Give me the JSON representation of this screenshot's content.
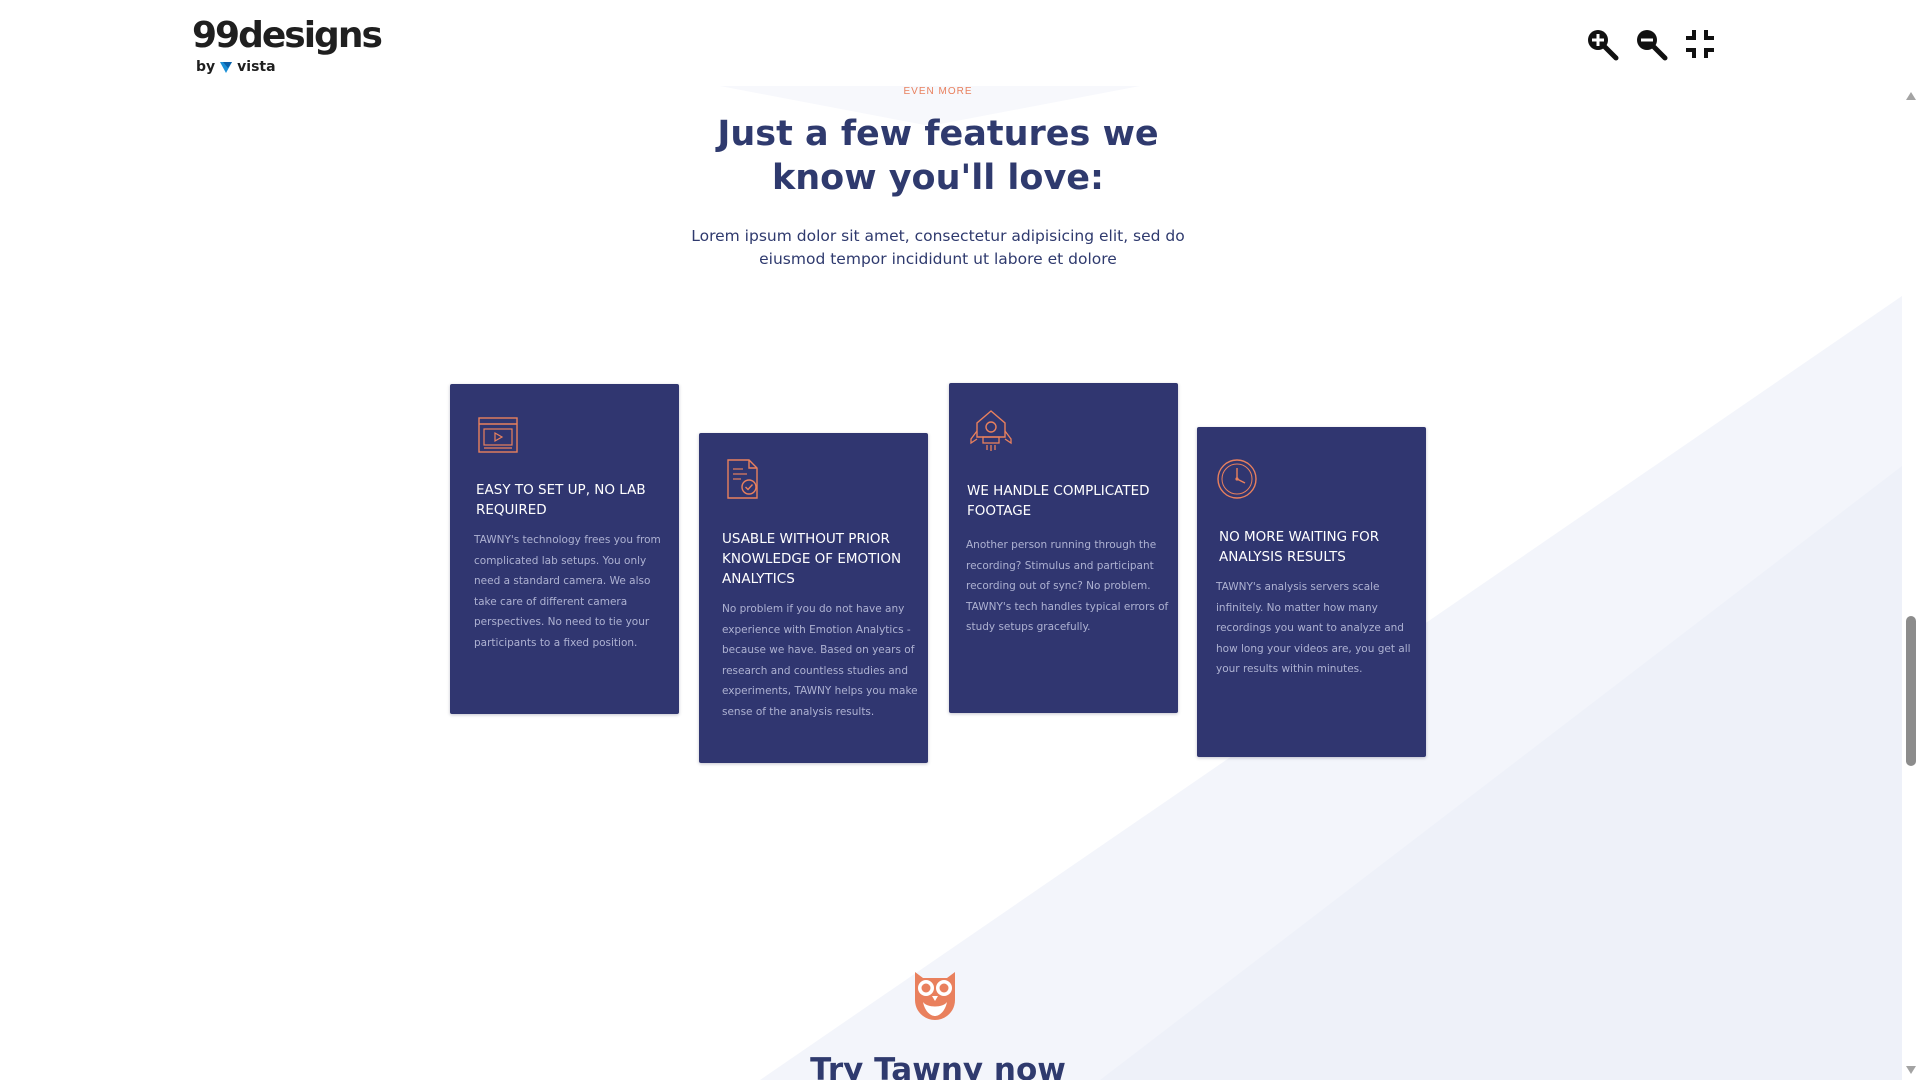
{
  "viewer": {
    "brand": {
      "name": "99designs",
      "by_text": "by",
      "partner": "vista"
    },
    "controls": [
      {
        "name": "zoom-in",
        "icon": "zoom-in-icon"
      },
      {
        "name": "zoom-out",
        "icon": "zoom-out-icon"
      },
      {
        "name": "exit-fullscreen",
        "icon": "collapse-icon"
      }
    ]
  },
  "section": {
    "eyebrow": "EVEN MORE",
    "headline": "Just a few features we know you'll love:",
    "subtext": "Lorem ipsum dolor sit amet, consectetur adipisicing elit, sed do eiusmod tempor incididunt ut labore et dolore"
  },
  "features": [
    {
      "icon": "video-player-icon",
      "title": "EASY TO SET UP, NO LAB REQUIRED",
      "body": "TAWNY's technology frees you from complicated lab setups. You only need a standard camera. We also take care of different camera perspectives. No need to tie your participants to a fixed position."
    },
    {
      "icon": "document-check-icon",
      "title": "USABLE WITHOUT PRIOR KNOWLEDGE OF EMOTION ANALYTICS",
      "body": "No problem if you do not have any experience with Emotion Analytics - because we have. Based on years of research and countless studies and experiments, TAWNY helps you make sense of the analysis results."
    },
    {
      "icon": "spaceship-icon",
      "title": "WE HANDLE COMPLICATED FOOTAGE",
      "body": "Another person running through the recording? Stimulus and participant recording out of sync? No problem. TAWNY's tech handles typical errors of study setups gracefully."
    },
    {
      "icon": "clock-icon",
      "title": "NO MORE WAITING FOR ANALYSIS RESULTS",
      "body": "TAWNY's analysis servers scale infinitely. No matter how many recordings you want to analyze and how long your videos are, you get all your results within minutes."
    }
  ],
  "cta": {
    "icon": "owl-icon",
    "title": "Try Tawny now"
  },
  "colors": {
    "card_bg": "#303670",
    "heading": "#2f3a6e",
    "accent": "#e9805d",
    "card_text": "#aeb2d2"
  }
}
